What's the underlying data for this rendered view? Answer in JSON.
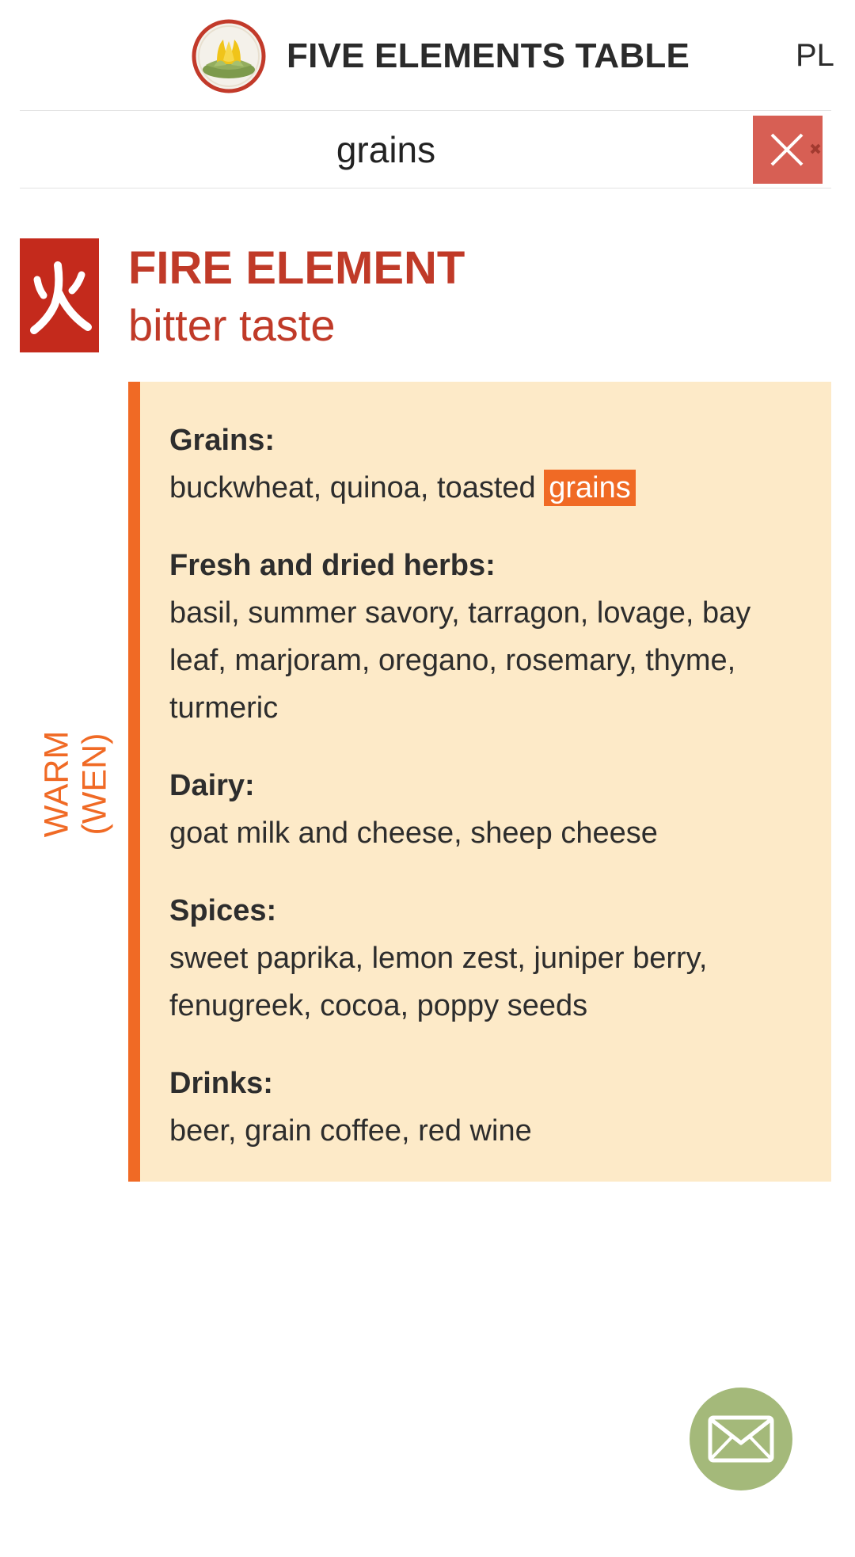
{
  "header": {
    "title": "FIVE ELEMENTS TABLE",
    "language": "PL",
    "logo_icon": "lotus-logo-icon"
  },
  "search": {
    "value": "grains",
    "clear_icon": "close-icon"
  },
  "element": {
    "title": "FIRE ELEMENT",
    "taste": "bitter taste",
    "icon": "fire-character-icon",
    "color": "#c42a1c",
    "temperature_line1": "WARM",
    "temperature_line2": "(WEN)"
  },
  "sections": [
    {
      "title": "Grains:",
      "body": "buckwheat, quinoa, toasted ",
      "highlight": "grains"
    },
    {
      "title": "Fresh and dried herbs:",
      "body": "basil, summer savory, tarragon, lovage, bay leaf, marjoram, oregano, rosemary, thyme, turmeric"
    },
    {
      "title": "Dairy:",
      "body": "goat milk and cheese, sheep cheese"
    },
    {
      "title": "Spices:",
      "body": "sweet paprika, lemon zest, juniper berry, fenugreek, cocoa, poppy seeds"
    },
    {
      "title": "Drinks:",
      "body": "beer, grain coffee, red wine"
    }
  ],
  "colors": {
    "accent_orange": "#f06a25",
    "card_background": "#fdeac8",
    "clear_button": "#d75f54",
    "mail_button": "#a4b97a"
  },
  "contact": {
    "icon": "mail-icon"
  }
}
